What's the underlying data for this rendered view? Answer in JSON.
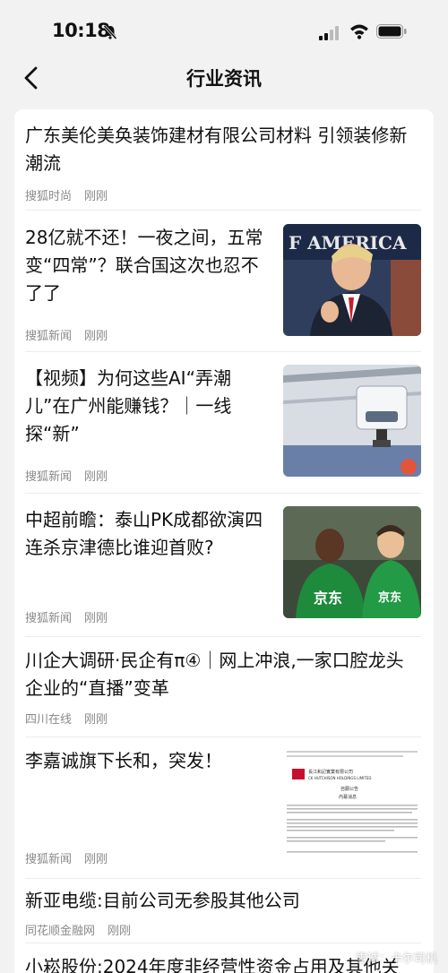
{
  "status_bar": {
    "time": "10:18"
  },
  "nav": {
    "title": "行业资讯"
  },
  "articles": [
    {
      "title": "广东美伦美奂装饰建材有限公司材料 引领装修新潮流",
      "source": "搜狐时尚",
      "time": "刚刚",
      "has_image": false
    },
    {
      "title": "28亿就不还！一夜之间，五常变“四常”？联合国这次也忍不了了",
      "source": "搜狐新闻",
      "time": "刚刚",
      "has_image": true
    },
    {
      "title": "【视频】为何这些AI“弄潮儿”在广州能赚钱？｜一线探“新”",
      "source": "搜狐新闻",
      "time": "刚刚",
      "has_image": true
    },
    {
      "title": "中超前瞻：泰山PK成都欲演四连杀京津德比谁迎首败?",
      "source": "搜狐新闻",
      "time": "刚刚",
      "has_image": true
    },
    {
      "title": "川企大调研·民企有π④｜网上冲浪,一家口腔龙头企业的“直播”变革",
      "source": "四川在线",
      "time": "刚刚",
      "has_image": false
    },
    {
      "title": "李嘉诚旗下长和，突发！",
      "source": "搜狐新闻",
      "time": "刚刚",
      "has_image": true
    },
    {
      "title": "新亚电缆:目前公司无参股其他公司",
      "source": "同花顺金融网",
      "time": "刚刚",
      "has_image": false
    },
    {
      "title": "小崧股份:2024年度非经营性资金占用及其他关",
      "source": "",
      "time": "",
      "has_image": false
    }
  ],
  "thumbs": {
    "img1_text": "F AMERICA",
    "img4_text": "京东",
    "img5_company": "CK HUTCHISON HOLDINGS LIMITED",
    "img5_company_cn": "長江和記實業有限公司",
    "img5_heading": "自願公告",
    "img5_sub": "內幕消息"
  },
  "watermark": "雪球：卡尔司机",
  "colors": {
    "meta": "#8a8a8a",
    "card": "#ffffff",
    "background": "#f2f2f2"
  }
}
